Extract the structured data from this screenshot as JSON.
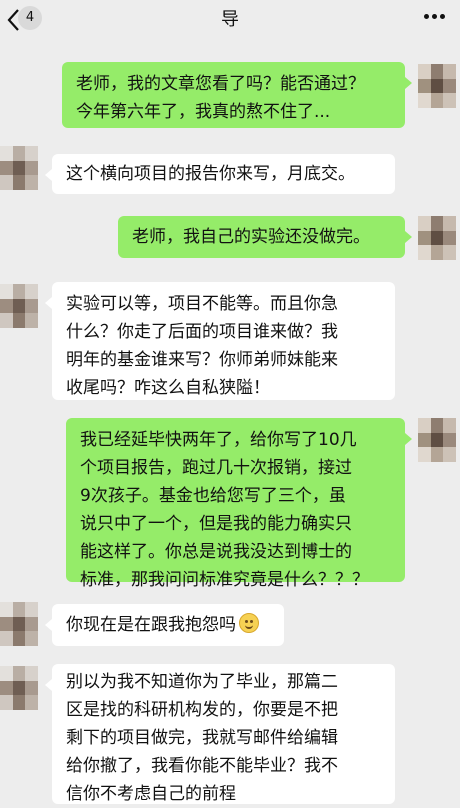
{
  "header": {
    "back_icon": "chevron-left-icon",
    "unread_count": "4",
    "title": "导",
    "more_icon": "ellipsis-icon"
  },
  "messages": [
    {
      "from": "me",
      "lines": [
        "老师，我的文章您看了吗？能否通过？",
        "今年第六年了，我真的熬不住了..."
      ]
    },
    {
      "from": "teacher",
      "lines": [
        "这个横向项目的报告你来写，月底交。"
      ]
    },
    {
      "from": "me",
      "lines": [
        "老师，我自己的实验还没做完。"
      ]
    },
    {
      "from": "teacher",
      "lines": [
        "实验可以等，项目不能等。而且你急",
        "什么？你走了后面的项目谁来做？我",
        "明年的基金谁来写？你师弟师妹能来",
        "收尾吗？咋这么自私狭隘！"
      ]
    },
    {
      "from": "me",
      "lines": [
        "我已经延毕快两年了，给你写了10几",
        "个项目报告，跑过几十次报销，接过",
        "9次孩子。基金也给您写了三个，虽",
        "说只中了一个，但是我的能力确实只",
        "能这样了。你总是说我没达到博士的",
        "标准，那我问问标准究竟是什么？？？"
      ]
    },
    {
      "from": "teacher",
      "lines": [
        "你现在是在跟我抱怨吗"
      ],
      "emoji": "smile-emoji"
    },
    {
      "from": "teacher",
      "lines": [
        "别以为我不知道你为了毕业，那篇二",
        "区是找的科研机构发的，你要是不把",
        "剩下的项目做完，我就写邮件给编辑",
        "给你撤了，我看你能不能毕业？我不",
        "信你不考虑自己的前程"
      ]
    }
  ],
  "colors": {
    "background": "#ededed",
    "incoming_bubble": "#ffffff",
    "outgoing_bubble": "#95ec69"
  }
}
